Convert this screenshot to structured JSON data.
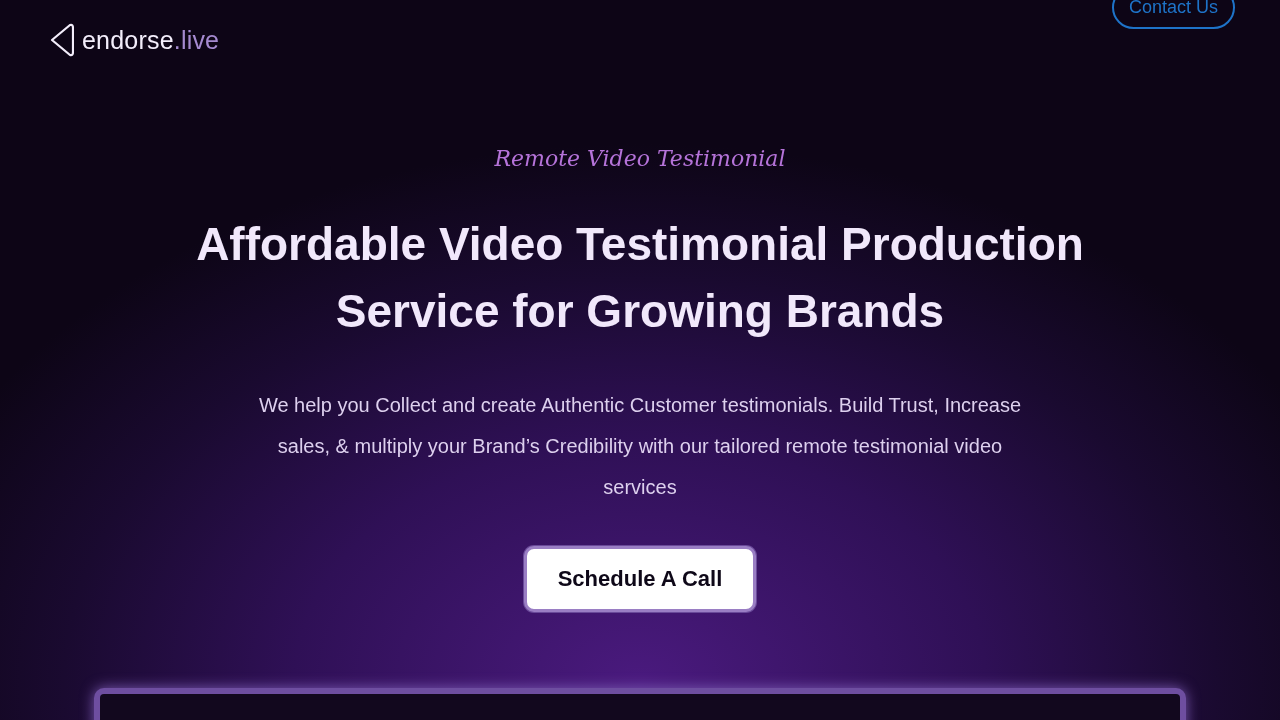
{
  "header": {
    "logo": "**endorse**.live",
    "contact_button": "Contact Us"
  },
  "hero": {
    "eyebrow": "Remote Video Testimonial",
    "title": "Affordable Video Testimonial Production Service for Growing Brands",
    "description": "We help you Collect and create Authentic Customer testimonials. Build Trust, Increase sales, & multiply your Brand’s Credibility with our tailored remote testimonial video services",
    "cta": "Schedule A Call"
  }
}
